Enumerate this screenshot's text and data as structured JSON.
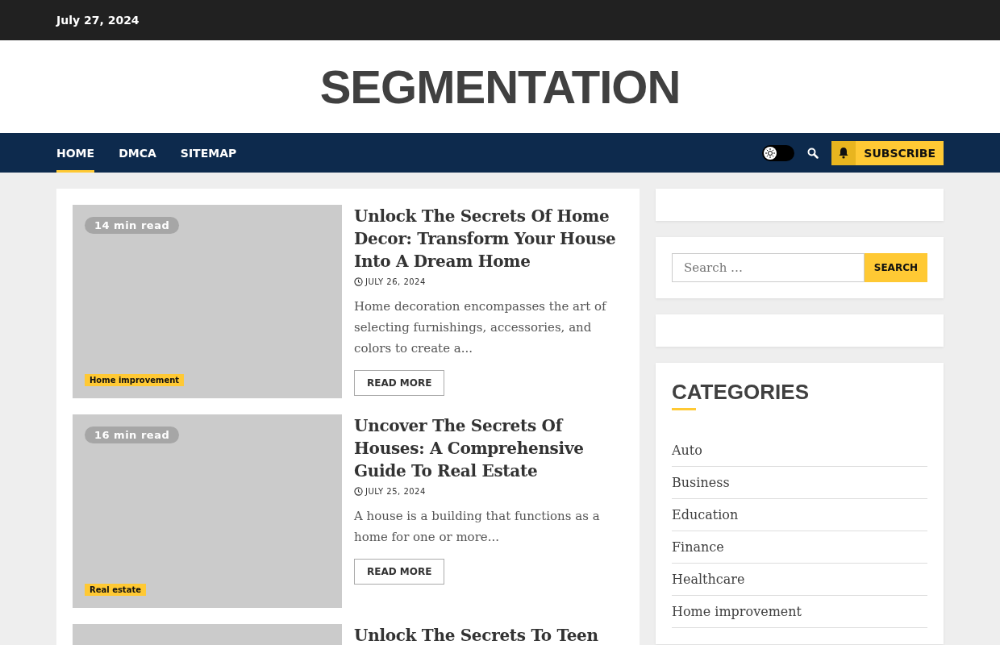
{
  "top_bar": {
    "date": "July 27, 2024"
  },
  "site_title": "SEGMENTATION",
  "nav": {
    "items": [
      {
        "label": "HOME",
        "selected": true
      },
      {
        "label": "DMCA",
        "selected": false
      },
      {
        "label": "SITEMAP",
        "selected": false
      }
    ],
    "dark_mode": false,
    "subscribe": "SUBSCRIBE"
  },
  "posts": [
    {
      "read_time": "14 min read",
      "category": "Home improvement",
      "title": "Unlock The Secrets Of Home Decor: Transform Your House Into A Dream Home",
      "date": "JULY 26, 2024",
      "excerpt": "Home decoration encompasses the art of selecting furnishings, accessories, and colors to create a...",
      "button": "READ MORE"
    },
    {
      "read_time": "16 min read",
      "category": "Real estate",
      "title": "Uncover The Secrets Of Houses: A Comprehensive Guide To Real Estate",
      "date": "JULY 25, 2024",
      "excerpt": "A house is a building that functions as a home for one or more...",
      "button": "READ MORE"
    },
    {
      "title": "Unlock The Secrets To Teen"
    }
  ],
  "sidebar": {
    "search": {
      "placeholder": "Search …",
      "button": "SEARCH"
    },
    "categories": {
      "heading": "CATEGORIES",
      "items": [
        "Auto",
        "Business",
        "Education",
        "Finance",
        "Healthcare",
        "Home improvement"
      ]
    }
  }
}
